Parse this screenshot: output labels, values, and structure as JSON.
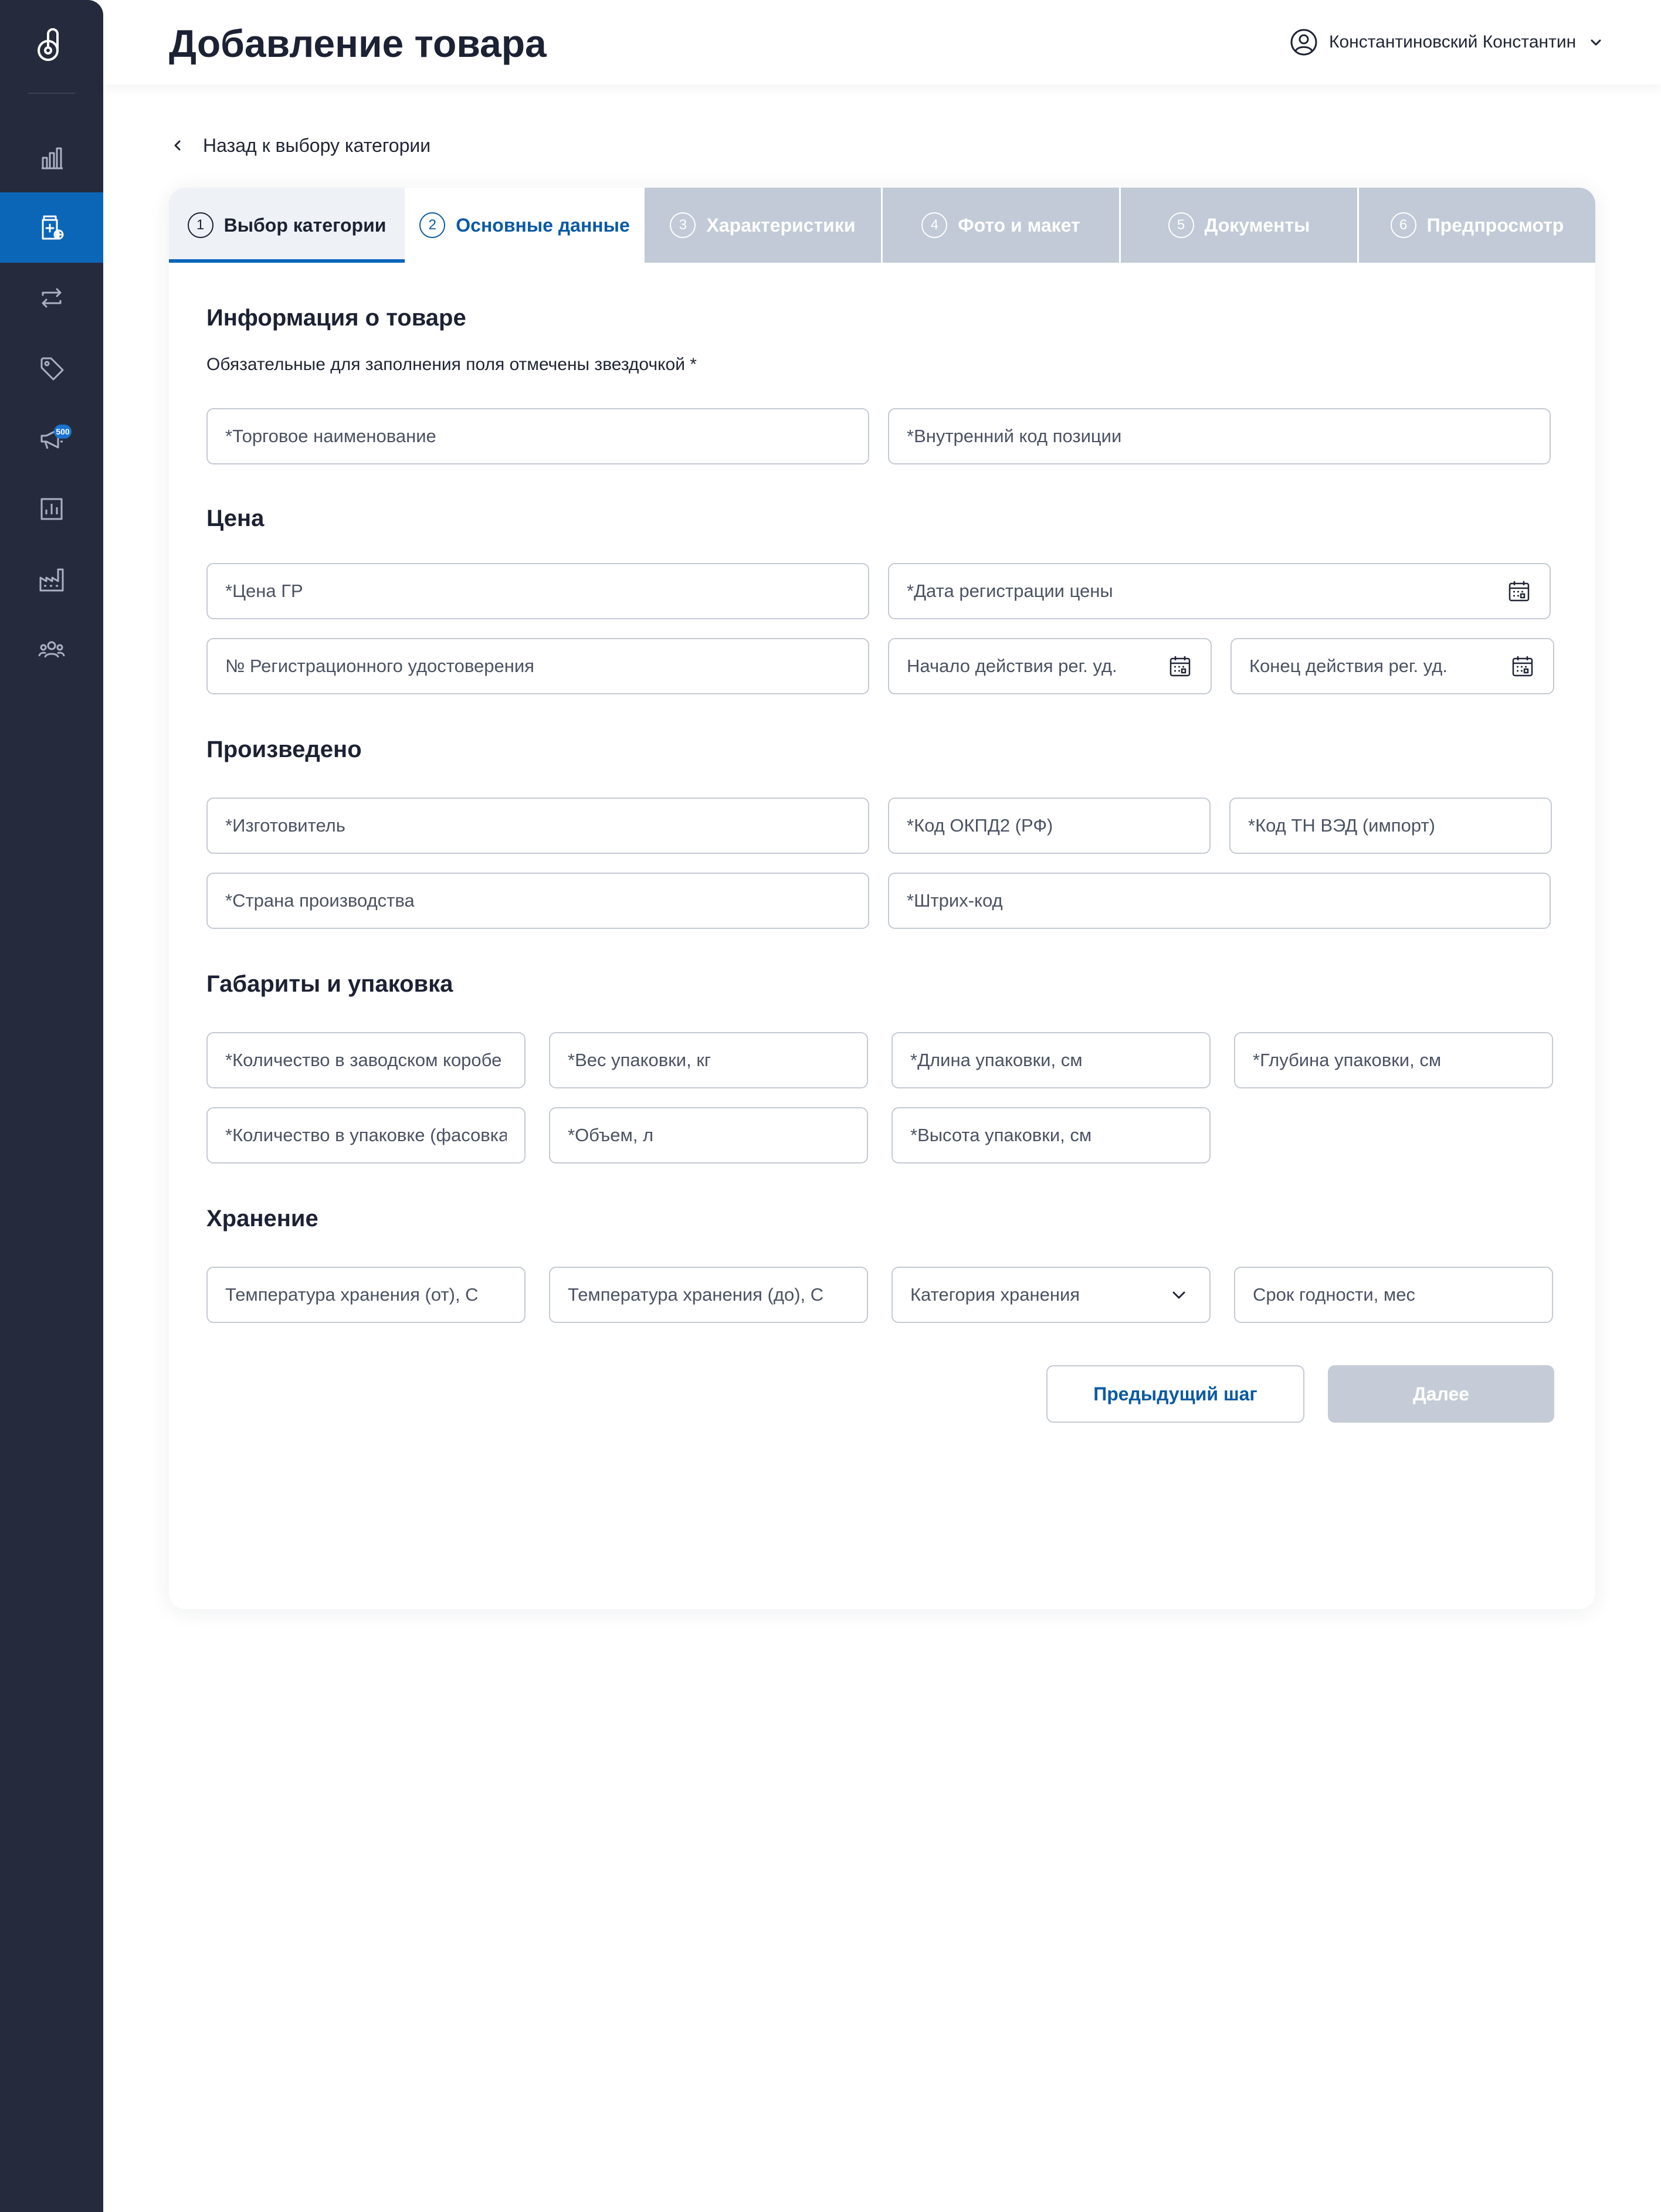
{
  "app": {
    "page_title": "Добавление товара"
  },
  "user": {
    "name": "Константиновский Константин"
  },
  "sidebar": {
    "items": [
      {
        "icon": "bar-chart-icon",
        "active": false
      },
      {
        "icon": "add-product-icon",
        "active": true
      },
      {
        "icon": "exchange-icon",
        "active": false
      },
      {
        "icon": "tag-icon",
        "active": false
      },
      {
        "icon": "megaphone-icon",
        "active": false,
        "badge": "500"
      },
      {
        "icon": "report-icon",
        "active": false
      },
      {
        "icon": "factory-icon",
        "active": false
      },
      {
        "icon": "users-icon",
        "active": false
      }
    ]
  },
  "back_link": {
    "label": "Назад к выбору категории"
  },
  "steps": [
    {
      "num": "1",
      "label": "Выбор категории",
      "state": "done"
    },
    {
      "num": "2",
      "label": "Основные данные",
      "state": "current"
    },
    {
      "num": "3",
      "label": "Характеристики",
      "state": "pending"
    },
    {
      "num": "4",
      "label": "Фото и макет",
      "state": "pending"
    },
    {
      "num": "5",
      "label": "Документы",
      "state": "pending"
    },
    {
      "num": "6",
      "label": "Предпросмотр",
      "state": "pending"
    }
  ],
  "form": {
    "info": {
      "title": "Информация о товаре",
      "hint": "Обязательные для заполнения поля отмечены звездочкой *",
      "trade_name": "*Торговое наименование",
      "internal_code": "*Внутренний код позиции"
    },
    "price": {
      "title": "Цена",
      "price_gr": "*Цена ГР",
      "price_reg_date": "*Дата регистрации цены",
      "reg_cert_no": "№ Регистрационного удостоверения",
      "reg_start": "Начало действия рег. уд.",
      "reg_end": "Конец действия рег. уд."
    },
    "produced": {
      "title": "Произведено",
      "manufacturer": "*Изготовитель",
      "okpd2": "*Код ОКПД2 (РФ)",
      "tnved": "*Код ТН ВЭД (импорт)",
      "country": "*Страна производства",
      "barcode": "*Штрих-код"
    },
    "dimensions": {
      "title": "Габариты и упаковка",
      "qty_box": "*Количество в заводском коробе",
      "weight": "*Вес упаковки, кг",
      "length": "*Длина упаковки, см",
      "depth": "*Глубина упаковки, см",
      "qty_pack": "*Количество в упаковке (фасовка)",
      "volume": "*Объем, л",
      "height": "*Высота упаковки, см"
    },
    "storage": {
      "title": "Хранение",
      "temp_from": "Температура хранения (от), С",
      "temp_to": "Температура хранения (до), С",
      "category": "Категория хранения",
      "shelf_life": "Срок годности, мес"
    }
  },
  "actions": {
    "prev_label": "Предыдущий шаг",
    "next_label": "Далее"
  },
  "colors": {
    "sidebar_bg": "#252b3c",
    "accent": "#0b66b8",
    "disabled": "#c5ccd7"
  }
}
